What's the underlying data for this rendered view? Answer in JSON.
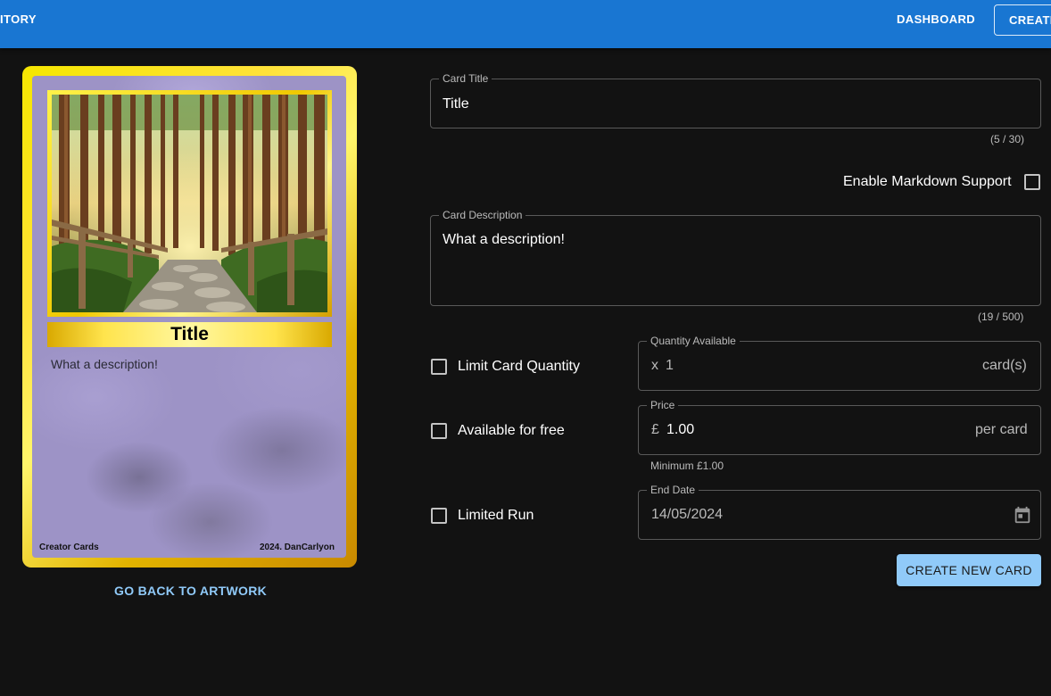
{
  "nav": {
    "left_label": "ITORY",
    "dashboard_label": "DASHBOARD",
    "create_label": "CREATE"
  },
  "card_preview": {
    "title": "Title",
    "description": "What a description!",
    "footer_left": "Creator Cards",
    "footer_right": "2024. DanCarlyon",
    "image_icon": "forest-path-image"
  },
  "back_link": "GO BACK TO ARTWORK",
  "form": {
    "card_title": {
      "label": "Card Title",
      "value": "Title",
      "counter": "(5 / 30)"
    },
    "markdown": {
      "label": "Enable Markdown Support",
      "checked": false
    },
    "card_description": {
      "label": "Card Description",
      "value": "What a description!",
      "counter": "(19 / 500)"
    },
    "limit_quantity": {
      "label": "Limit Card Quantity",
      "checked": false
    },
    "quantity": {
      "label": "Quantity Available",
      "prefix": "x",
      "value": "1",
      "suffix": "card(s)"
    },
    "free": {
      "label": "Available for free",
      "checked": false
    },
    "price": {
      "label": "Price",
      "prefix": "£",
      "value": "1.00",
      "suffix": "per card",
      "helper": "Minimum £1.00"
    },
    "limited_run": {
      "label": "Limited Run",
      "checked": false
    },
    "end_date": {
      "label": "End Date",
      "value": "14/05/2024",
      "icon": "calendar-icon"
    },
    "submit_label": "CREATE NEW CARD"
  },
  "colors": {
    "appbar": "#1976d2",
    "background": "#121212",
    "accent": "#90caf9"
  }
}
